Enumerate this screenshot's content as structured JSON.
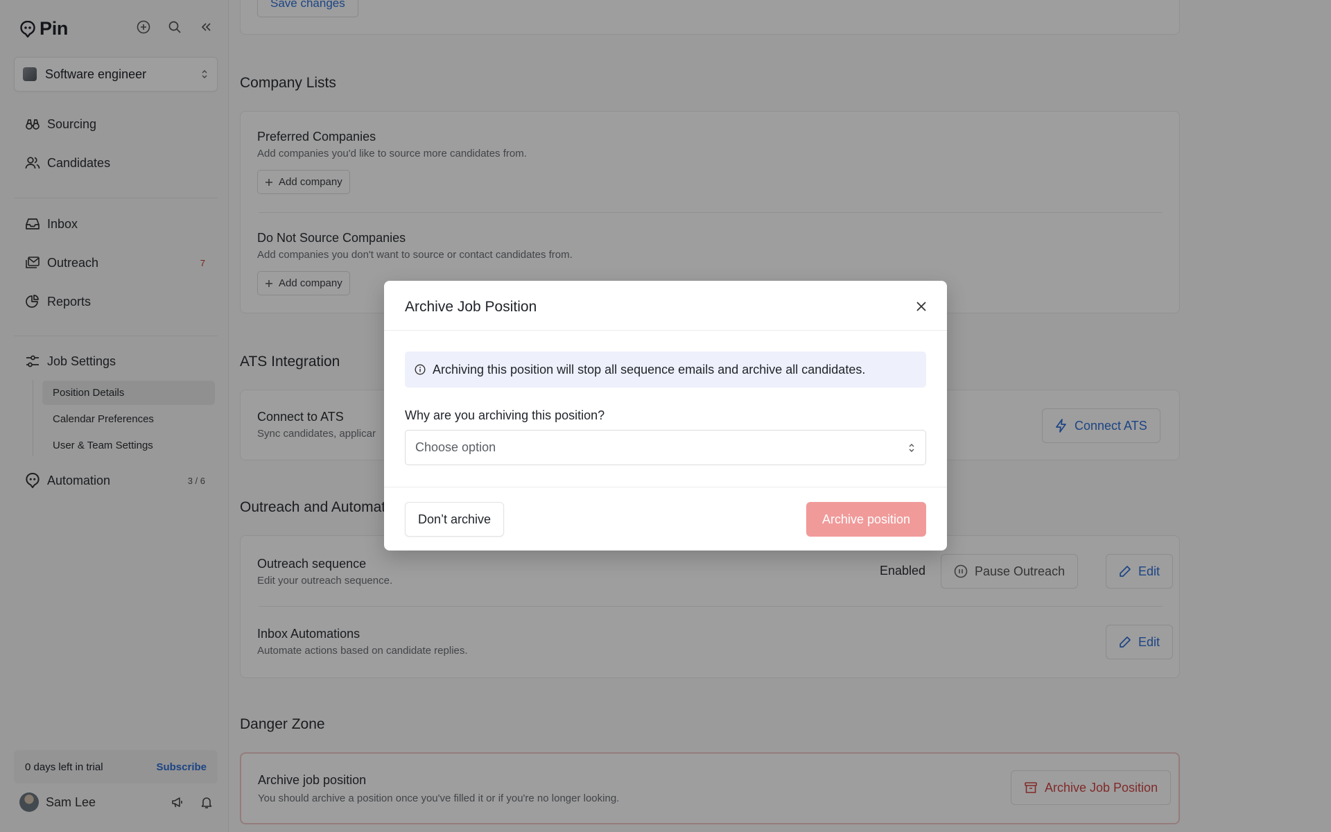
{
  "app": {
    "name": "Pin"
  },
  "sidebar": {
    "job_selector": {
      "value": "Software engineer"
    },
    "nav": [
      {
        "label": "Sourcing",
        "icon": "binoculars-icon"
      },
      {
        "label": "Candidates",
        "icon": "users-icon"
      },
      {
        "label": "Inbox",
        "icon": "inbox-icon"
      },
      {
        "label": "Outreach",
        "icon": "mail-stack-icon",
        "badge": "7"
      },
      {
        "label": "Reports",
        "icon": "pie-chart-icon"
      },
      {
        "label": "Job Settings",
        "icon": "sliders-icon"
      },
      {
        "label": "Automation",
        "icon": "pin-logo-icon",
        "count": "3 / 6"
      }
    ],
    "job_settings_sub": [
      {
        "label": "Position Details",
        "active": true
      },
      {
        "label": "Calendar Preferences",
        "active": false
      },
      {
        "label": "User & Team Settings",
        "active": false
      }
    ],
    "trial": {
      "text": "0 days left in trial",
      "action": "Subscribe"
    },
    "user": {
      "name": "Sam Lee"
    }
  },
  "main": {
    "save_button": "Save changes",
    "company_lists": {
      "title": "Company Lists",
      "preferred": {
        "title": "Preferred Companies",
        "desc": "Add companies you'd like to source more candidates from.",
        "button": "Add company"
      },
      "do_not_source": {
        "title": "Do Not Source Companies",
        "desc": "Add companies you don't want to source or contact candidates from.",
        "button": "Add company"
      }
    },
    "ats": {
      "title": "ATS Integration",
      "row_title": "Connect to ATS",
      "row_desc": "Sync candidates, applicar",
      "button": "Connect ATS"
    },
    "outreach": {
      "title": "Outreach and Automat",
      "sequence": {
        "title": "Outreach sequence",
        "desc": "Edit your outreach sequence.",
        "status": "Enabled",
        "pause": "Pause Outreach",
        "edit": "Edit"
      },
      "inbox": {
        "title": "Inbox Automations",
        "desc": "Automate actions based on candidate replies.",
        "edit": "Edit"
      }
    },
    "danger": {
      "title": "Danger Zone",
      "row_title": "Archive job position",
      "row_desc": "You should archive a position once you've filled it or if you're no longer looking.",
      "button": "Archive Job Position"
    }
  },
  "modal": {
    "title": "Archive Job Position",
    "info": "Archiving this position will stop all sequence emails and archive all candidates.",
    "question": "Why are you archiving this position?",
    "select_placeholder": "Choose option",
    "cancel": "Don’t archive",
    "confirm": "Archive position"
  },
  "colors": {
    "accent": "#2f6fd6",
    "danger": "#d04545",
    "confirm_disabled": "#f19a9a"
  }
}
